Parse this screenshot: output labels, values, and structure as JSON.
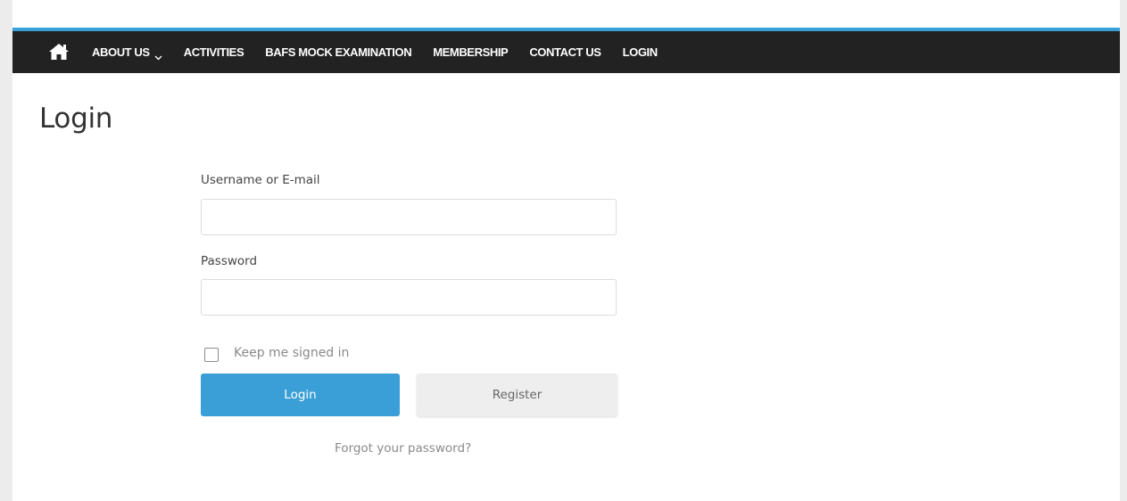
{
  "colors": {
    "accent": "#3a9fd6",
    "navbar_bg": "#222222",
    "page_bg": "#ffffff",
    "outer_bg": "#ececec"
  },
  "nav": {
    "home_icon": "home-icon",
    "items": [
      {
        "label": "ABOUT US",
        "has_dropdown": true
      },
      {
        "label": "ACTIVITIES"
      },
      {
        "label": "BAFS MOCK EXAMINATION"
      },
      {
        "label": "MEMBERSHIP"
      },
      {
        "label": "CONTACT US"
      },
      {
        "label": "LOGIN"
      }
    ]
  },
  "page": {
    "title": "Login"
  },
  "form": {
    "username_label": "Username or E-mail",
    "username_value": "",
    "password_label": "Password",
    "password_value": "",
    "remember_label": "Keep me signed in",
    "remember_checked": false,
    "login_button": "Login",
    "register_button": "Register",
    "forgot_link": "Forgot your password?"
  }
}
